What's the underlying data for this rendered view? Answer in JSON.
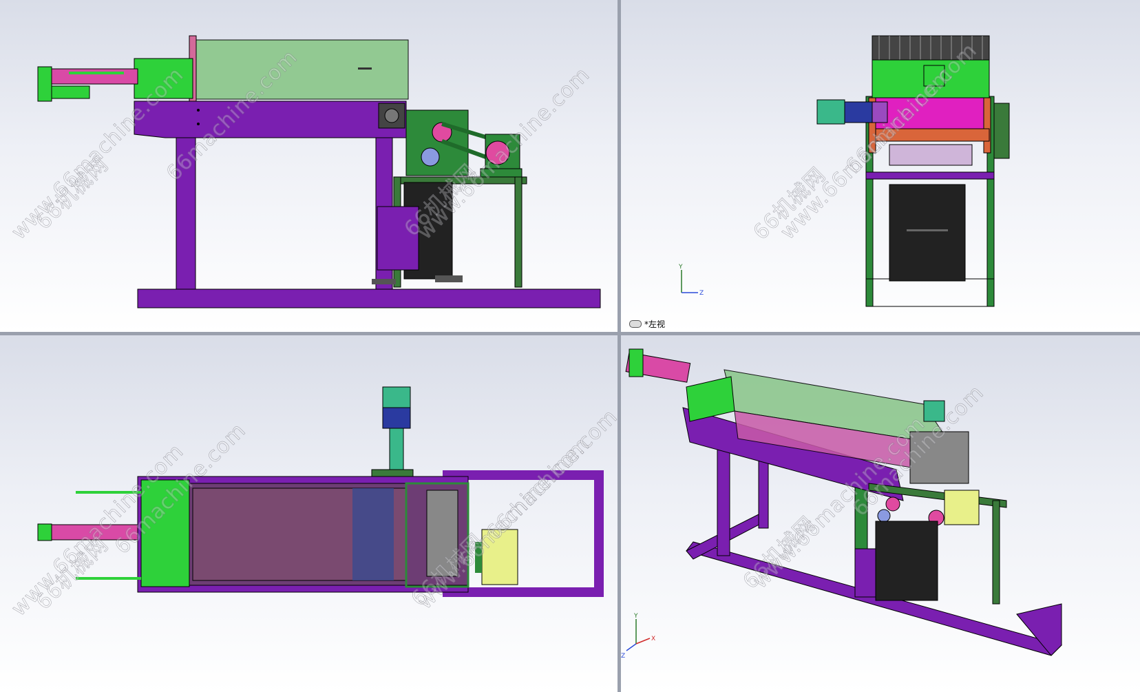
{
  "watermark": {
    "brand": "66machine.com",
    "url": "www.66machine.com",
    "cn": "66机械网"
  },
  "left_view": {
    "label": "*左视",
    "view_icon": "view-orientation-icon"
  },
  "axes": {
    "y": "Y",
    "z": "Z",
    "x": "X"
  },
  "colors": {
    "frame_purple": "#7a1fb0",
    "hopper_green": "#2ed13a",
    "motor_yellow": "#e8f08a",
    "roller_magenta": "#e020c0",
    "bin_black": "#222222",
    "stand_green": "#1f6b2a"
  }
}
